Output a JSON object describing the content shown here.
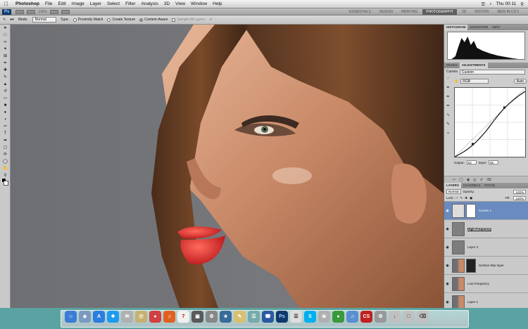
{
  "menubar": {
    "app_name": "Photoshop",
    "items": [
      "File",
      "Edit",
      "Image",
      "Layer",
      "Select",
      "Filter",
      "Analysis",
      "3D",
      "View",
      "Window",
      "Help"
    ],
    "clock": "Thu 00:11"
  },
  "workspace_bar": {
    "app_badge": "Ps",
    "zoom": "115%",
    "workspaces": [
      "ESSENTIALS",
      "DESIGN",
      "PAINTING",
      "PHOTOGRAPHY",
      "3D",
      "MOTION",
      "NEW IN CS 5"
    ],
    "active_workspace": "PHOTOGRAPHY"
  },
  "options_bar": {
    "mode_label": "Mode:",
    "mode_value": "Normal",
    "type_label": "Type:",
    "proximity_match": "Proximity Match",
    "create_texture": "Create Texture",
    "content_aware": "Content-Aware",
    "sample_all_layers": "Sample All Layers"
  },
  "panels": {
    "histogram_tabs": [
      "HISTOGRAM",
      "NAVIGATOR",
      "INFO"
    ],
    "adjust_tabs": [
      "MASKS",
      "ADJUSTMENTS"
    ],
    "curves_label": "Curves",
    "preset_value": "Custom",
    "channel_value": "RGB",
    "auto_label": "Auto",
    "output_label": "Output:",
    "output_value": "54",
    "input_label": "Input:",
    "input_value": "65",
    "layers_tabs": [
      "LAYERS",
      "CHANNELS",
      "PATHS"
    ],
    "blend_mode": "Normal",
    "opacity_label": "Opacity:",
    "opacity_value": "100%",
    "lock_label": "Lock:",
    "fill_label": "Fill:",
    "fill_value": "100%",
    "layers": [
      {
        "name": "Curves 1",
        "selected": true
      },
      {
        "name": "High Frequency",
        "selected": false
      },
      {
        "name": "Layer 3",
        "selected": false
      },
      {
        "name": "Surface Blur layer",
        "selected": false
      },
      {
        "name": "Low Frequency",
        "selected": false
      },
      {
        "name": "Layer 1",
        "selected": false
      }
    ]
  },
  "colors": {
    "accent": "#6a8bbf",
    "dock_background": "#5aa3a2"
  }
}
